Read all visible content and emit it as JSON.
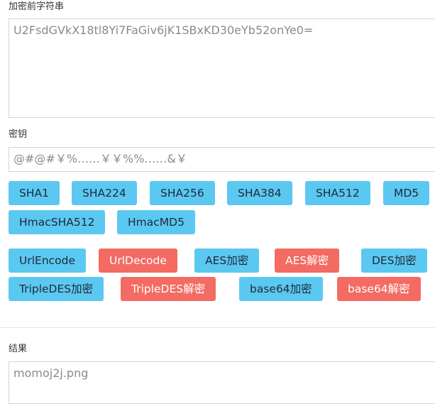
{
  "plaintext": {
    "label": "加密前字符串",
    "value": "U2FsdGVkX18tl8Yi7FaGiv6jK1SBxKD30eYb52onYe0="
  },
  "key": {
    "label": "密钥",
    "value": "@#@#￥%……￥￥%%……&￥"
  },
  "hash_buttons": {
    "sha1": "SHA1",
    "sha224": "SHA224",
    "sha256": "SHA256",
    "sha384": "SHA384",
    "sha512": "SHA512",
    "md5": "MD5",
    "hmac_sha512": "HmacSHA512",
    "hmac_md5": "HmacMD5"
  },
  "cipher_buttons": {
    "url_encode": "UrlEncode",
    "url_decode": "UrlDecode",
    "aes_encrypt": "AES加密",
    "aes_decrypt": "AES解密",
    "des_encrypt": "DES加密",
    "triple_des_encrypt": "TripleDES加密",
    "triple_des_decrypt": "TripleDES解密",
    "base64_encrypt": "base64加密",
    "base64_decrypt": "base64解密"
  },
  "result": {
    "label": "结果",
    "value": "momoj2j.png"
  },
  "colors": {
    "primary_button": "#5bc8f2",
    "decrypt_button": "#f36b62"
  }
}
